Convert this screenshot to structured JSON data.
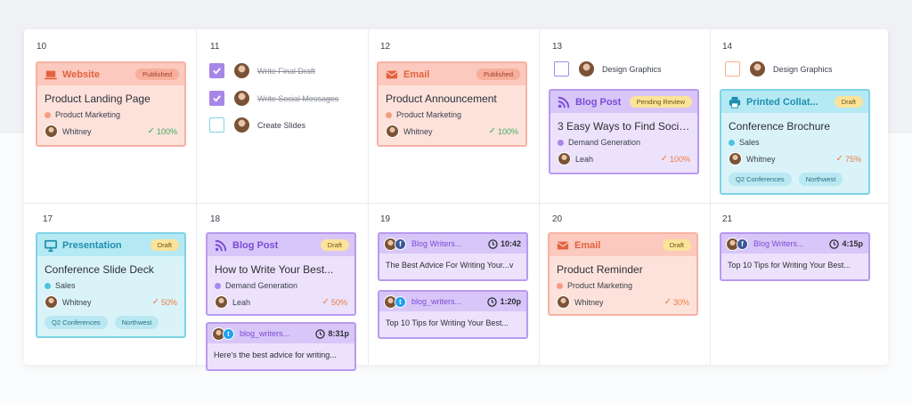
{
  "days": {
    "d10": "10",
    "d11": "11",
    "d12": "12",
    "d13": "13",
    "d14": "14",
    "d17": "17",
    "d18": "18",
    "d19": "19",
    "d20": "20",
    "d21": "21"
  },
  "colors": {
    "website_orange": "#e2623f",
    "blog_purple": "#7a4bd6",
    "print_cyan": "#1f8fae",
    "progress_green": "#3fae5c",
    "progress_orange": "#ef7b3d"
  },
  "cards": {
    "website": {
      "type": "Website",
      "icon": "laptop-icon",
      "status": "Published",
      "title": "Product Landing Page",
      "category": "Product Marketing",
      "owner": "Whitney",
      "progress": "100%"
    },
    "email1": {
      "type": "Email",
      "icon": "envelope-icon",
      "status": "Published",
      "title": "Product Announcement",
      "category": "Product Marketing",
      "owner": "Whitney",
      "progress": "100%"
    },
    "blog1": {
      "type": "Blog Post",
      "icon": "rss-icon",
      "status": "Pending Review",
      "title": "3 Easy Ways to Find Social...",
      "category": "Demand Generation",
      "owner": "Leah",
      "progress": "100%"
    },
    "print": {
      "type": "Printed Collat...",
      "icon": "printer-icon",
      "status": "Draft",
      "title": "Conference Brochure",
      "category": "Sales",
      "owner": "Whitney",
      "progress": "75%",
      "tags": [
        "Q2 Conferences",
        "Northwest"
      ]
    },
    "presentation": {
      "type": "Presentation",
      "icon": "presentation-icon",
      "status": "Draft",
      "title": "Conference Slide Deck",
      "category": "Sales",
      "owner": "Whitney",
      "progress": "50%",
      "tags": [
        "Q2 Conferences",
        "Northwest"
      ]
    },
    "blog2": {
      "type": "Blog Post",
      "icon": "rss-icon",
      "status": "Draft",
      "title": "How to Write Your Best...",
      "category": "Demand Generation",
      "owner": "Leah",
      "progress": "50%"
    },
    "email2": {
      "type": "Email",
      "icon": "envelope-icon",
      "status": "Draft",
      "title": "Product Reminder",
      "category": "Product Marketing",
      "owner": "Whitney",
      "progress": "30%"
    }
  },
  "social": {
    "s18": {
      "network": "twitter",
      "account": "blog_writers...",
      "time": "8:31p",
      "text": "Here's the best advice for writing..."
    },
    "s19a": {
      "network": "facebook",
      "account": "Blog Writers...",
      "time": "10:42",
      "text": "The Best Advice For Writing Your...v"
    },
    "s19b": {
      "network": "twitter",
      "account": "blog_writers...",
      "time": "1:20p",
      "text": "Top 10 Tips for Writing Your Best..."
    },
    "s21": {
      "network": "facebook",
      "account": "Blog Writers...",
      "time": "4:15p",
      "text": "Top 10 Tips for Writing Your Best..."
    }
  },
  "tasks": {
    "t1": {
      "label": "Write Final Draft",
      "done": true
    },
    "t2": {
      "label": "Write Social Messages",
      "done": true
    },
    "t3": {
      "label": "Create Slides",
      "done": false
    },
    "t4": {
      "label": "Design Graphics",
      "done": false
    },
    "t5": {
      "label": "Design Graphics",
      "done": false
    }
  }
}
